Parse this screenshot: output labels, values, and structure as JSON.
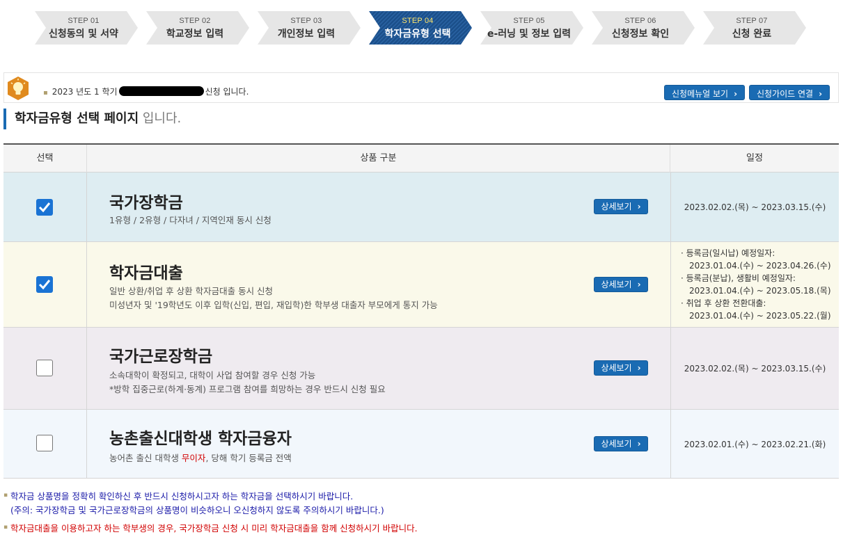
{
  "steps": [
    {
      "num": "STEP 01",
      "name": "신청동의 및 서약",
      "active": false
    },
    {
      "num": "STEP 02",
      "name": "학교정보 입력",
      "active": false
    },
    {
      "num": "STEP 03",
      "name": "개인정보 입력",
      "active": false
    },
    {
      "num": "STEP 04",
      "name": "학자금유형 선택",
      "active": true
    },
    {
      "num": "STEP 05",
      "name": "e-러닝 및 정보 입력",
      "active": false
    },
    {
      "num": "STEP 06",
      "name": "신청정보 확인",
      "active": false
    },
    {
      "num": "STEP 07",
      "name": "신청 완료",
      "active": false
    }
  ],
  "info": {
    "icon": "lightbulb-icon",
    "text_before": "2023 년도 1 학기",
    "text_after": "신청 입니다.",
    "manual_button": "신청메뉴얼 보기",
    "guide_button": "신청가이드 연결"
  },
  "page_title": {
    "strong": "학자금유형 선택 페이지",
    "light": " 입니다."
  },
  "table": {
    "headers": {
      "select": "선택",
      "product": "상품 구분",
      "schedule": "일정"
    },
    "detail_label": "상세보기",
    "rows": [
      {
        "name": "국가장학금",
        "desc": [
          "1유형 / 2유형 / 다자녀 / 지역인재 동시 신청"
        ],
        "checked": true,
        "schedule": "2023.02.02.(목) ~ 2023.03.15.(수)",
        "bg": "#deedf2"
      },
      {
        "name": "학자금대출",
        "desc": [
          "일반 상환/취업 후 상환 학자금대출 동시 신청",
          "미성년자 및 '19학년도 이후 입학(신입, 편입, 재입학)한 학부생 대출자 부모에게 통지 가능"
        ],
        "checked": true,
        "schedule_list": [
          {
            "label": "· 등록금(일시납) 예정일자:",
            "date": "2023.01.04.(수) ~ 2023.04.26.(수)"
          },
          {
            "label": "· 등록금(분납), 생활비 예정일자:",
            "date": "2023.01.04.(수) ~ 2023.05.18.(목)"
          },
          {
            "label": "· 취업 후 상환 전환대출:",
            "date": "2023.01.04.(수) ~ 2023.05.22.(월)"
          }
        ],
        "bg": "#faf9ea"
      },
      {
        "name": "국가근로장학금",
        "desc": [
          "소속대학이 확정되고, 대학이 사업 참여할 경우 신청 가능",
          "*방학 집중근로(하계·동계) 프로그램 참여를 희망하는 경우 반드시 신청 필요"
        ],
        "checked": false,
        "schedule": "2023.02.02.(목) ~ 2023.03.15.(수)",
        "bg": "#efebf0"
      },
      {
        "name": "농촌출신대학생 학자금융자",
        "desc_pre": "농어촌 출신 대학생 ",
        "desc_red": "무이자",
        "desc_post": ", 당해 학기 등록금 전액",
        "checked": false,
        "schedule": "2023.02.01.(수) ~ 2023.02.21.(화)",
        "bg": "#f2f7fc"
      }
    ]
  },
  "notes": {
    "line1": "학자금 상품명을 정확히 확인하신 후 반드시 신청하시고자 하는 학자금을 선택하시기 바랍니다.",
    "line2": "(주의: 국가장학금 및 국가근로장학금의 상품명이 비슷하오니 오신청하지 않도록 주의하시기 바랍니다.)",
    "line3": "학자금대출을 이용하고자 하는 학부생의 경우, 국가장학금 신청 시 미리 학자금대출을 함께 신청하시기 바랍니다."
  },
  "colors": {
    "accent": "#1a6bb3",
    "active_step": "#1b4f8a",
    "inactive_step": "#e6e6e6",
    "checkbox": "#1a73d4",
    "warning_red": "#d10000",
    "note_blue": "#1a1aa8"
  }
}
